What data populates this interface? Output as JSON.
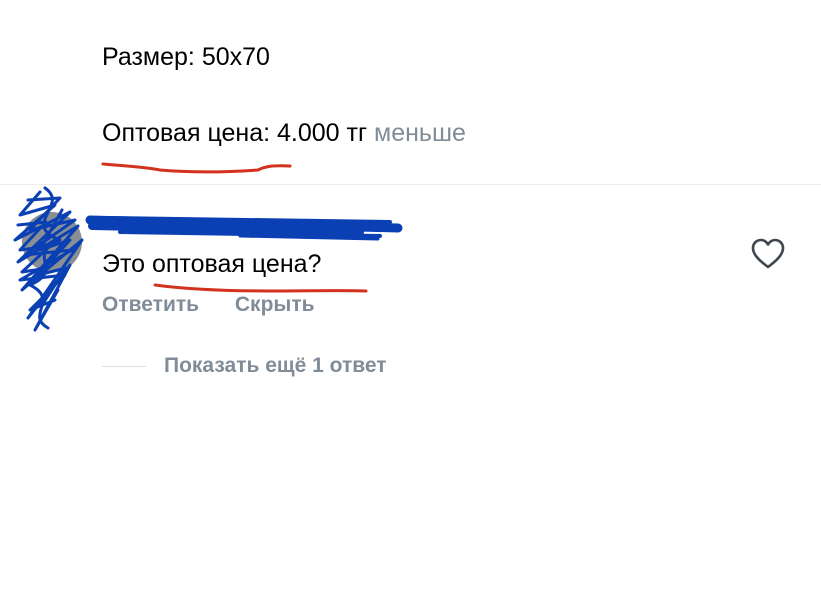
{
  "post": {
    "size_text": "Размер: 50x70",
    "price_text": "Оптовая цена: 4.000 тг",
    "less_link": "меньше"
  },
  "comment": {
    "author": "",
    "text": "Это оптовая цена?",
    "reply_label": "Ответить",
    "hide_label": "Скрыть",
    "like_icon": "heart-outline-icon"
  },
  "replies": {
    "show_more_label": "Показать ещё 1 ответ"
  },
  "colors": {
    "secondary_text": "#818c99",
    "annotation_underline": "#d2321e",
    "redaction_scribble": "#0a40b4",
    "divider": "#ececec"
  }
}
